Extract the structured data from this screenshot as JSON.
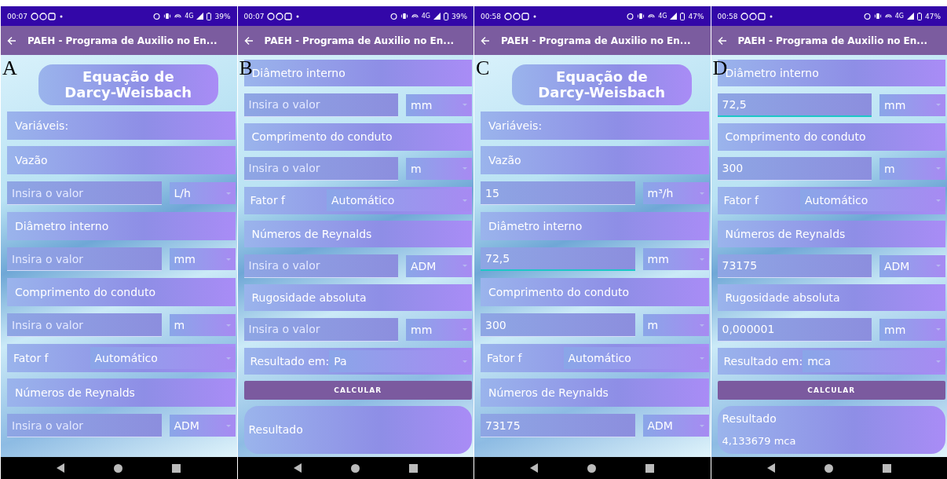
{
  "panels": [
    {
      "label": "A",
      "status": {
        "time": "00:07",
        "network": "4G",
        "battery": "39%"
      },
      "app_bar": {
        "title": "PAEH - Programa de Auxilio no En..."
      },
      "rows": [
        {
          "kind": "title",
          "text": "Equação de Darcy-Weisbach"
        },
        {
          "kind": "label",
          "text": "Variáveis:"
        },
        {
          "kind": "label",
          "text": "Vazão"
        },
        {
          "kind": "input",
          "placeholder": "Insira o valor",
          "unit": "L/h",
          "focused": false
        },
        {
          "kind": "label",
          "text": "Diâmetro interno"
        },
        {
          "kind": "input",
          "placeholder": "Insira o valor",
          "unit": "mm",
          "focused": false
        },
        {
          "kind": "label",
          "text": "Comprimento do conduto"
        },
        {
          "kind": "input",
          "placeholder": "Insira o valor",
          "unit": "m",
          "focused": false
        },
        {
          "kind": "select",
          "text": "Fator f",
          "value": "Automático"
        },
        {
          "kind": "label",
          "text": "Números de Reynalds"
        },
        {
          "kind": "input",
          "placeholder": "Insira o valor",
          "unit": "ADM",
          "focused": false
        }
      ]
    },
    {
      "label": "B",
      "status": {
        "time": "00:07",
        "network": "4G",
        "battery": "39%"
      },
      "app_bar": {
        "title": "PAEH - Programa de Auxilio no En..."
      },
      "rows": [
        {
          "kind": "label",
          "text": "Diâmetro interno"
        },
        {
          "kind": "input",
          "placeholder": "Insira o valor",
          "unit": "mm",
          "focused": false
        },
        {
          "kind": "label",
          "text": "Comprimento do conduto"
        },
        {
          "kind": "input",
          "placeholder": "Insira o valor",
          "unit": "m",
          "focused": false
        },
        {
          "kind": "select",
          "text": "Fator f",
          "value": "Automático"
        },
        {
          "kind": "label",
          "text": "Números de Reynalds"
        },
        {
          "kind": "input",
          "placeholder": "Insira o valor",
          "unit": "ADM",
          "focused": false
        },
        {
          "kind": "label",
          "text": "Rugosidade absoluta"
        },
        {
          "kind": "input",
          "placeholder": "Insira o valor",
          "unit": "mm",
          "focused": false
        },
        {
          "kind": "select",
          "text": "Resultado em:",
          "value": "Pa"
        },
        {
          "kind": "button",
          "text": "CALCULAR"
        },
        {
          "kind": "result",
          "text": "Resultado"
        }
      ]
    },
    {
      "label": "C",
      "status": {
        "time": "00:58",
        "network": "4G",
        "battery": "47%"
      },
      "app_bar": {
        "title": "PAEH - Programa de Auxilio no En..."
      },
      "rows": [
        {
          "kind": "title",
          "text": "Equação de Darcy-Weisbach"
        },
        {
          "kind": "label",
          "text": "Variáveis:"
        },
        {
          "kind": "label",
          "text": "Vazão"
        },
        {
          "kind": "input",
          "value": "15",
          "unit": "m³/h",
          "focused": false
        },
        {
          "kind": "label",
          "text": "Diâmetro interno"
        },
        {
          "kind": "input",
          "value": "72,5",
          "unit": "mm",
          "focused": true
        },
        {
          "kind": "label",
          "text": "Comprimento do conduto"
        },
        {
          "kind": "input",
          "value": "300",
          "unit": "m",
          "focused": false
        },
        {
          "kind": "select",
          "text": "Fator f",
          "value": "Automático"
        },
        {
          "kind": "label",
          "text": "Números de Reynalds"
        },
        {
          "kind": "input",
          "value": "73175",
          "unit": "ADM",
          "focused": false
        }
      ]
    },
    {
      "label": "D",
      "status": {
        "time": "00:58",
        "network": "4G",
        "battery": "47%"
      },
      "app_bar": {
        "title": "PAEH - Programa de Auxilio no En..."
      },
      "rows": [
        {
          "kind": "label",
          "text": "Diâmetro interno"
        },
        {
          "kind": "input",
          "value": "72,5",
          "unit": "mm",
          "focused": true
        },
        {
          "kind": "label",
          "text": "Comprimento do conduto"
        },
        {
          "kind": "input",
          "value": "300",
          "unit": "m",
          "focused": false
        },
        {
          "kind": "select",
          "text": "Fator f",
          "value": "Automático"
        },
        {
          "kind": "label",
          "text": "Números de Reynalds"
        },
        {
          "kind": "input",
          "value": "73175",
          "unit": "ADM",
          "focused": false
        },
        {
          "kind": "label",
          "text": "Rugosidade absoluta"
        },
        {
          "kind": "input",
          "value": "0,000001",
          "unit": "mm",
          "focused": false
        },
        {
          "kind": "select",
          "text": "Resultado em:",
          "value": "mca"
        },
        {
          "kind": "button",
          "text": "CALCULAR"
        },
        {
          "kind": "result",
          "text": "Resultado",
          "value": "4,133679 mca"
        }
      ]
    }
  ]
}
